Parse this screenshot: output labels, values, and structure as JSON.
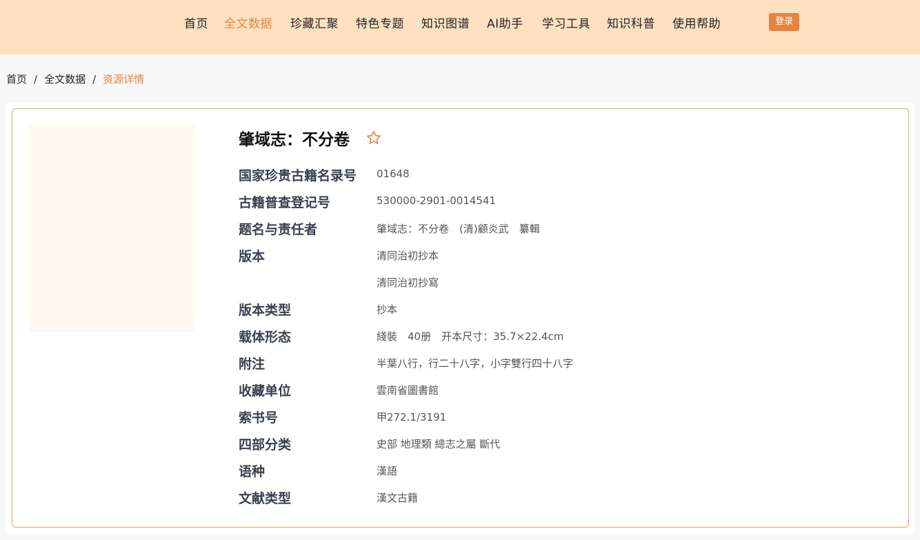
{
  "nav": {
    "items": [
      "首页",
      "全文数据",
      "珍藏汇聚",
      "特色专题",
      "知识图谱",
      "AI助手",
      "学习工具",
      "知识科普",
      "使用帮助"
    ],
    "active": "全文数据",
    "login": "登录"
  },
  "breadcrumb": {
    "items": [
      "首页",
      "全文数据",
      "资源详情"
    ],
    "separator": "/"
  },
  "book": {
    "title": "肇域志：不分卷",
    "favorite_icon": "star-outline-icon",
    "fields": [
      {
        "label": "国家珍贵古籍名录号",
        "values": [
          "01648"
        ]
      },
      {
        "label": "古籍普查登记号",
        "values": [
          "530000-2901-0014541"
        ]
      },
      {
        "label": "题名与责任者",
        "values": [
          "肇域志：不分卷　(清)顧炎武　纂輯"
        ]
      },
      {
        "label": "版本",
        "values": [
          "清同治初抄本",
          "清同治初抄寫"
        ]
      },
      {
        "label": "版本类型",
        "values": [
          "抄本"
        ]
      },
      {
        "label": "载体形态",
        "values": [
          "綫裝　40册　开本尺寸：35.7×22.4cm"
        ]
      },
      {
        "label": "附注",
        "values": [
          "半葉八行，行二十八字，小字雙行四十八字"
        ]
      },
      {
        "label": "收藏单位",
        "values": [
          "雲南省圖書館"
        ]
      },
      {
        "label": "索书号",
        "values": [
          "甲272.1/3191"
        ]
      },
      {
        "label": "四部分类",
        "values": [
          "史部 地理類 總志之屬 斷代"
        ]
      },
      {
        "label": "语种",
        "values": [
          "漢語"
        ]
      },
      {
        "label": "文献类型",
        "values": [
          "漢文古籍"
        ]
      }
    ]
  },
  "colors": {
    "accent": "#e6843f",
    "header_bg": "#ffe1c2",
    "card_border": "#e0a070"
  }
}
